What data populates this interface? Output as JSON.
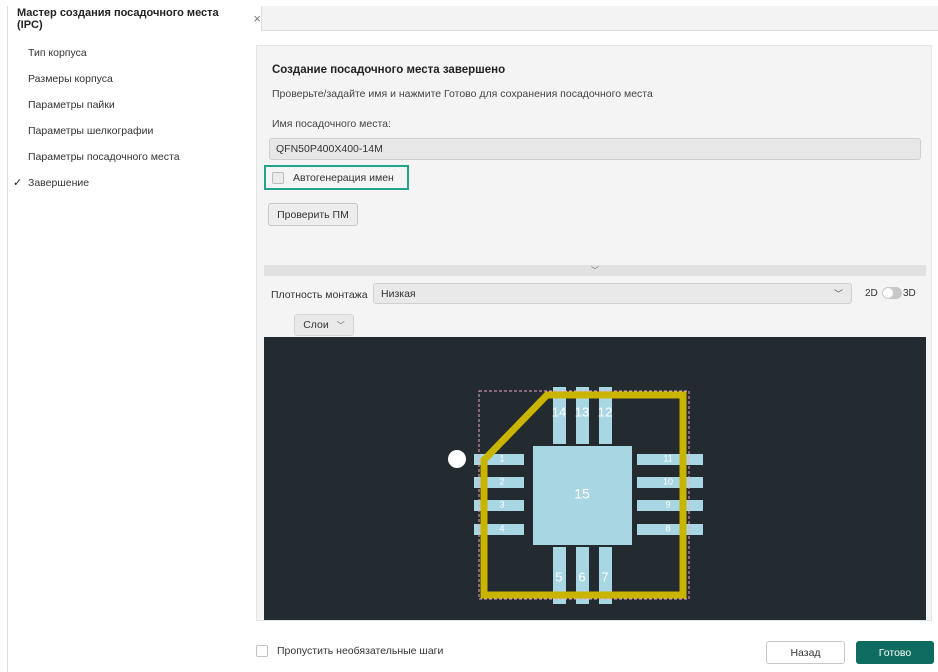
{
  "tab": {
    "title": "Мастер создания посадочного места (IPC)",
    "close": "×"
  },
  "sidebar": {
    "items": [
      {
        "label": "Тип корпуса",
        "done": false
      },
      {
        "label": "Размеры корпуса",
        "done": false
      },
      {
        "label": "Параметры пайки",
        "done": false
      },
      {
        "label": "Параметры шелкографии",
        "done": false
      },
      {
        "label": "Параметры посадочного места",
        "done": false
      },
      {
        "label": "Завершение",
        "done": true
      }
    ],
    "check_glyph": "✓"
  },
  "main": {
    "title": "Создание посадочного места завершено",
    "subtitle": "Проверьте/задайте имя и нажмите Готово для сохранения посадочного места",
    "name_label": "Имя посадочного места:",
    "name_value": "QFN50P400X400-14M",
    "autogen_label": "Автогенерация имен",
    "autogen_checked": false,
    "check_button": "Проверить ПМ",
    "collapse_glyph": "﹀",
    "density_label": "Плотность монтажа",
    "density_value": "Низкая",
    "density_arrow": "﹀",
    "view_2d": "2D",
    "view_3d": "3D",
    "layers_button": "Слои",
    "layers_arrow": "﹀"
  },
  "preview": {
    "pin_labels": [
      "1",
      "2",
      "3",
      "4",
      "5",
      "6",
      "7",
      "8",
      "9",
      "10",
      "11",
      "12",
      "13",
      "14"
    ],
    "center_pad_label": "15",
    "colors": {
      "background": "#232a30",
      "pad": "#a9d6e3",
      "pad_text": "#ffffff",
      "silkscreen": "#c9b400",
      "courtyard": "#e8a7c8",
      "pin1_marker": "#ffffff"
    }
  },
  "footer": {
    "skip_label": "Пропустить необязательные шаги",
    "back_button": "Назад",
    "done_button": "Готово",
    "done_color": "#0d6b5f"
  }
}
